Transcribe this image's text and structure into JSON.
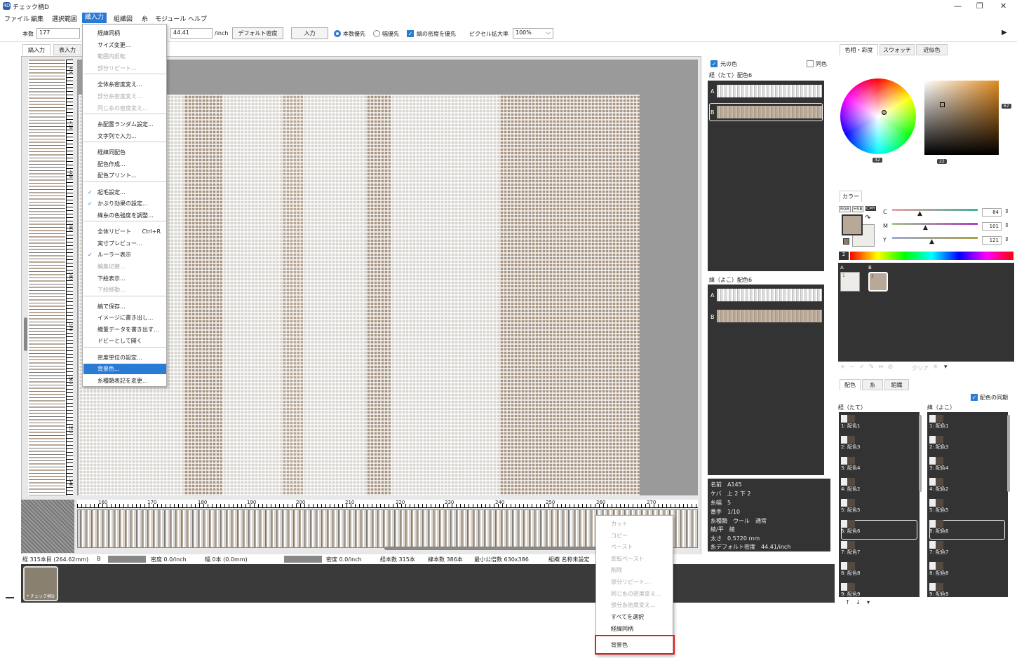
{
  "title": "チェック柄D",
  "menu": [
    "ファイル",
    "編集",
    "選択範囲",
    "織入力",
    "組織図",
    "糸",
    "モジュール",
    "ヘルプ"
  ],
  "toolbar": {
    "count_label": "本数",
    "count_value": "177",
    "density_value": "44.41",
    "density_unit": "/inch",
    "default_density": "デフォルト密度",
    "input_btn": "入力",
    "radio1": "本数優先",
    "radio2": "幅優先",
    "check1": "縞の密度を優先",
    "zoom_label": "ピクセル拡大率",
    "zoom_value": "100%"
  },
  "left_tabs": [
    "縞入力",
    "表入力"
  ],
  "dropdown": [
    {
      "label": "経緯同柄",
      "state": "normal"
    },
    {
      "label": "サイズ変更...",
      "state": "normal"
    },
    {
      "label": "範囲内反転",
      "state": "disabled"
    },
    {
      "label": "部分リピート...",
      "state": "disabled"
    },
    {
      "label": "全体糸密度変え...",
      "state": "normal"
    },
    {
      "label": "部分糸密度変え...",
      "state": "disabled"
    },
    {
      "label": "同じ糸の密度変え...",
      "state": "disabled"
    },
    {
      "label": "糸配置ランダム設定...",
      "state": "normal"
    },
    {
      "label": "文字列で入力...",
      "state": "normal"
    },
    {
      "label": "経緯同配色",
      "state": "normal"
    },
    {
      "label": "配色作成...",
      "state": "normal"
    },
    {
      "label": "配色プリント...",
      "state": "normal"
    },
    {
      "label": "起毛設定...",
      "state": "checked"
    },
    {
      "label": "かぶり効果の設定...",
      "state": "checked"
    },
    {
      "label": "緯糸の色強度を調整...",
      "state": "normal"
    },
    {
      "label": "全体リピート",
      "state": "normal",
      "shortcut": "Ctrl+R"
    },
    {
      "label": "実寸プレビュー...",
      "state": "normal"
    },
    {
      "label": "ルーラー表示",
      "state": "checked"
    },
    {
      "label": "編集切替...",
      "state": "disabled"
    },
    {
      "label": "下絵表示...",
      "state": "normal"
    },
    {
      "label": "下絵移動...",
      "state": "disabled"
    },
    {
      "label": "縞で保存...",
      "state": "normal"
    },
    {
      "label": "イメージに書き出し...",
      "state": "normal"
    },
    {
      "label": "織董データを書き出す...",
      "state": "normal"
    },
    {
      "label": "ドビーとして開く",
      "state": "normal"
    },
    {
      "label": "密度単位の設定...",
      "state": "normal"
    },
    {
      "label": "背景色...",
      "state": "highlight"
    },
    {
      "label": "糸種類表記を変更...",
      "state": "normal"
    }
  ],
  "vruler_labels": [
    "420",
    "410",
    "400",
    "390",
    "380",
    "370",
    "360",
    "350",
    "340"
  ],
  "hruler_labels": [
    "160",
    "170",
    "180",
    "190",
    "200",
    "210",
    "220",
    "230",
    "240",
    "250",
    "260",
    "270"
  ],
  "status": {
    "left": "経 315本目 (264.62mm)",
    "b": "B",
    "density1": "密度 0.0/inch",
    "width": "幅 0本 (0.0mm)",
    "density2": "密度 0.0/inch",
    "warp_count": "経本数 315本",
    "weft_count": "緯本数 386本",
    "lcm": "最小公倍数 630x386",
    "weave": "組織 名称未設定"
  },
  "thumbnail_label": "* チェック柄D",
  "context_menu": [
    {
      "label": "カット",
      "state": "disabled"
    },
    {
      "label": "コピー",
      "state": "disabled"
    },
    {
      "label": "ペースト",
      "state": "disabled"
    },
    {
      "label": "反転ペースト",
      "state": "disabled"
    },
    {
      "label": "削除",
      "state": "disabled"
    },
    {
      "label": "部分リピート...",
      "state": "disabled"
    },
    {
      "label": "同じ糸の密度変え...",
      "state": "disabled"
    },
    {
      "label": "部分糸密度変え...",
      "state": "disabled"
    },
    {
      "label": "すべてを選択",
      "state": "normal"
    },
    {
      "label": "経緯同柄",
      "state": "normal"
    },
    {
      "label": "背景色",
      "state": "normal"
    }
  ],
  "mid": {
    "original_color": "元の色",
    "same_color": "同色",
    "warp_title": "経（たて）配色6",
    "weft_title": "緯（よこ）配色6",
    "a": "A",
    "b": "B"
  },
  "info": [
    "名前　A145",
    "ケバ　上 2 下 2",
    "糸幅　5",
    "番手　1/10",
    "糸種類　ウール　通常",
    "綾/平　綾",
    "太さ　0.5720 mm",
    "糸デフォルト密度　44.41/inch"
  ],
  "right": {
    "tabs": [
      "色相・彩度",
      "スウォッチ",
      "近似色"
    ],
    "badge_v": "67",
    "badge_h": "32",
    "badge_s": "22",
    "color_tab": "カラー",
    "modes": [
      "RGB",
      "HSB",
      "CMY"
    ],
    "c_label": "C",
    "m_label": "M",
    "y_label": "Y",
    "c_value": "84",
    "m_value": "101",
    "y_value": "121",
    "spectrum_num": "2",
    "sw_a": "A",
    "sw_b": "B",
    "sw_1": "1",
    "sw_2": "2",
    "clear": "クリア",
    "bottom_tabs": [
      "配色",
      "糸",
      "組織"
    ],
    "sync": "配色の同期",
    "warp_list_title": "経（たて）",
    "weft_list_title": "緯（よこ）",
    "list_items": [
      "1: 配色1",
      "2: 配色3",
      "3: 配色4",
      "4: 配色2",
      "5: 配色5",
      "6: 配色6",
      "7: 配色7",
      "8: 配色8",
      "9: 配色9"
    ]
  },
  "colors": {
    "accent": "#2a7bd4",
    "beige": "#b7a898",
    "dark": "#333333"
  }
}
